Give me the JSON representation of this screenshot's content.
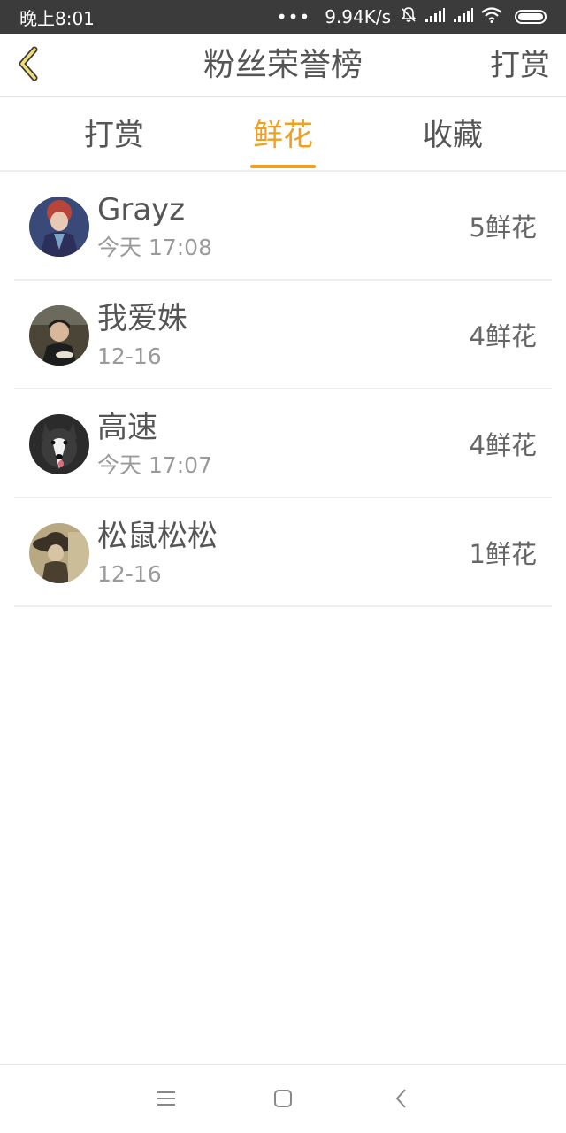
{
  "status_bar": {
    "time": "晚上8:01",
    "dots": "•••",
    "speed": "9.94K/s",
    "icons": [
      "bell-muted-icon",
      "signal-icon",
      "signal-icon",
      "wifi-icon",
      "battery-icon"
    ]
  },
  "header": {
    "title": "粉丝荣誉榜",
    "action_label": "打赏",
    "back_icon": "chevron-left-icon"
  },
  "tabs": [
    {
      "label": "打赏",
      "active": false
    },
    {
      "label": "鲜花",
      "active": true
    },
    {
      "label": "收藏",
      "active": false
    }
  ],
  "list": [
    {
      "name": "Grayz",
      "time": "今天 17:08",
      "count": "5鲜花"
    },
    {
      "name": "我爱姝",
      "time": "12-16",
      "count": "4鲜花"
    },
    {
      "name": "高速",
      "time": "今天 17:07",
      "count": "4鲜花"
    },
    {
      "name": "松鼠松松",
      "time": "12-16",
      "count": "1鲜花"
    }
  ],
  "nav_bar": {
    "icons": [
      "menu-icon",
      "home-square-icon",
      "back-arrow-icon"
    ]
  },
  "colors": {
    "accent": "#f0a01e",
    "status_bar_bg": "#3b3b3b",
    "text_primary": "#555555",
    "text_secondary": "#9a9a9a"
  }
}
